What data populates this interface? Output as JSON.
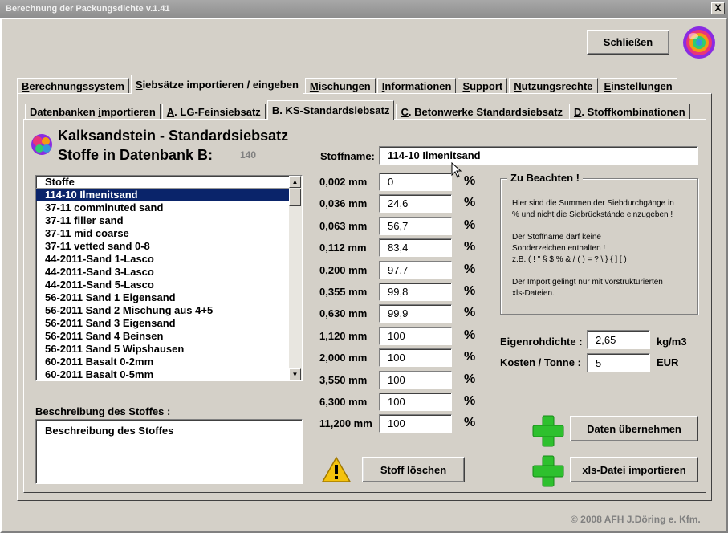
{
  "window": {
    "title": "Berechnung der Packungsdichte v.1.41",
    "close_glyph": "X"
  },
  "header": {
    "close_button": "Schließen"
  },
  "main_tabs": [
    {
      "label": "Berechnungssystem",
      "accel": "B",
      "rest": "erechnungssystem"
    },
    {
      "label": "Siebsätze importieren / eingeben",
      "accel": "S",
      "rest": "iebsätze importieren / eingeben"
    },
    {
      "label": "Mischungen",
      "accel": "M",
      "rest": "ischungen"
    },
    {
      "label": "Informationen",
      "accel": "I",
      "rest": "nformationen"
    },
    {
      "label": "Support",
      "accel": "S",
      "rest": "upport"
    },
    {
      "label": "Nutzungsrechte",
      "accel": "N",
      "rest": "utzungsrechte"
    },
    {
      "label": "Einstellungen",
      "accel": "E",
      "rest": "instellungen"
    }
  ],
  "sub_tabs": [
    {
      "label": "Datenbanken importieren",
      "pre": "Datenbanken ",
      "accel": "i",
      "rest": "mportieren"
    },
    {
      "label": "A. LG-Feinsiebsatz",
      "pre": "",
      "accel": "A",
      "rest": ". LG-Feinsiebsatz"
    },
    {
      "label": "B. KS-Standardsiebsatz",
      "pre": "B. KS-Standardsiebsatz",
      "accel": "",
      "rest": ""
    },
    {
      "label": "C. Betonwerke Standardsiebsatz",
      "pre": "",
      "accel": "C",
      "rest": ". Betonwerke Standardsiebsatz"
    },
    {
      "label": "D. Stoffkombinationen",
      "pre": "",
      "accel": "D",
      "rest": ". Stoffkombinationen"
    }
  ],
  "panel": {
    "title": "Kalksandstein - Standardsiebsatz",
    "subtitle": "Stoffe in Datenbank B:",
    "count": "140",
    "stoffname_label": "Stoffname:",
    "stoffname_value": "114-10 Ilmenitsand"
  },
  "list": {
    "header": "Stoffe",
    "selected_index": 0,
    "items": [
      "114-10 Ilmenitsand",
      "37-11 comminuted sand",
      "37-11 filler sand",
      "37-11 mid coarse",
      "37-11 vetted sand 0-8",
      "44-2011-Sand 1-Lasco",
      "44-2011-Sand 3-Lasco",
      "44-2011-Sand 5-Lasco",
      "56-2011 Sand 1 Eigensand",
      "56-2011 Sand 2 Mischung aus 4+5",
      "56-2011 Sand 3 Eigensand",
      "56-2011 Sand 4 Beinsen",
      "56-2011 Sand 5 Wipshausen",
      "60-2011 Basalt 0-2mm",
      "60-2011 Basalt 0-5mm"
    ]
  },
  "sieves": [
    {
      "size": "0,002 mm",
      "value": "0"
    },
    {
      "size": "0,036 mm",
      "value": "24,6"
    },
    {
      "size": "0,063 mm",
      "value": "56,7"
    },
    {
      "size": "0,112 mm",
      "value": "83,4"
    },
    {
      "size": "0,200 mm",
      "value": "97,7"
    },
    {
      "size": "0,355 mm",
      "value": "99,8"
    },
    {
      "size": "0,630 mm",
      "value": "99,9"
    },
    {
      "size": "1,120 mm",
      "value": "100"
    },
    {
      "size": "2,000 mm",
      "value": "100"
    },
    {
      "size": "3,550 mm",
      "value": "100"
    },
    {
      "size": "6,300 mm",
      "value": "100"
    },
    {
      "size": "11,200 mm",
      "value": "100"
    }
  ],
  "percent_sign": "%",
  "notes": {
    "title": "Zu Beachten !",
    "line1": "Hier sind die Summen der Siebdurchgänge in",
    "line2": "% und nicht die Siebrückstände einzugeben !",
    "line3": "Der Stoffname darf keine",
    "line4": "Sonderzeichen enthalten !",
    "line5": "z.B. ( ! \" § $ % & / ( ) = ? \\ } { ] [ )",
    "line6": "Der Import gelingt nur mit vorstrukturierten",
    "line7": "xls-Dateien."
  },
  "properties": {
    "density_label": "Eigenrohdichte :",
    "density_value": "2,65",
    "density_unit": "kg/m3",
    "cost_label": "Kosten / Tonne :",
    "cost_value": "5",
    "cost_unit": "EUR"
  },
  "description": {
    "label": "Beschreibung des Stoffes :",
    "value": "Beschreibung des Stoffes"
  },
  "actions": {
    "delete": "Stoff löschen",
    "apply": "Daten übernehmen",
    "import": "xls-Datei importieren"
  },
  "footer": "© 2008  AFH J.Döring e. Kfm.",
  "colors": {
    "selection": "#0a246a",
    "plus_green": "#2ec02e",
    "warning_yellow": "#f4c20d"
  }
}
